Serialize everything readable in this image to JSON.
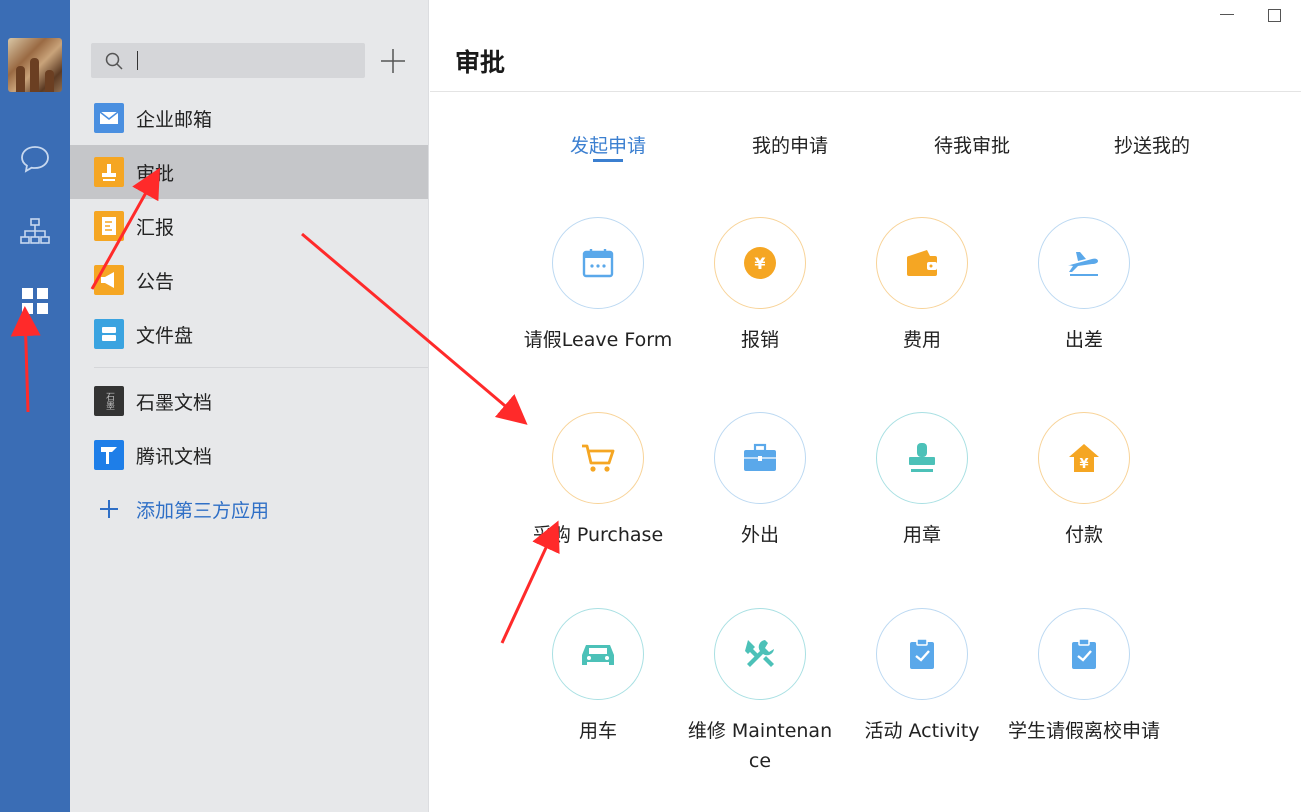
{
  "window": {
    "title": "审批"
  },
  "search": {
    "placeholder": ""
  },
  "nav": {
    "items": [
      {
        "label": "企业邮箱",
        "icon": "mail-icon",
        "color": "#4a8fe0"
      },
      {
        "label": "审批",
        "icon": "stamp-icon",
        "color": "#f5a623"
      },
      {
        "label": "汇报",
        "icon": "report-icon",
        "color": "#f5a623"
      },
      {
        "label": "公告",
        "icon": "megaphone-icon",
        "color": "#f5a623"
      },
      {
        "label": "文件盘",
        "icon": "storage-icon",
        "color": "#3aa3e0"
      },
      {
        "label": "石墨文档",
        "icon": "shimo-icon",
        "color": "#333333",
        "logo_text": "石墨"
      },
      {
        "label": "腾讯文档",
        "icon": "tencent-docs-icon",
        "color": "#1e7ee8"
      },
      {
        "label": "添加第三方应用",
        "icon": "plus-icon",
        "color": "#2f6fc6"
      }
    ]
  },
  "tabs": [
    "发起申请",
    "我的申请",
    "待我审批",
    "抄送我的"
  ],
  "active_tab": 0,
  "apps": [
    {
      "name": "请假Leave Form",
      "icon": "calendar-icon",
      "color": "#5aa8ea"
    },
    {
      "name": "报销",
      "icon": "yuan-coin-icon",
      "color": "#f5a623"
    },
    {
      "name": "费用",
      "icon": "wallet-icon",
      "color": "#f5a623"
    },
    {
      "name": "出差",
      "icon": "airplane-icon",
      "color": "#5aa8ea"
    },
    {
      "name": "采购 Purchase",
      "icon": "cart-icon",
      "color": "#f5a623"
    },
    {
      "name": "外出",
      "icon": "briefcase-icon",
      "color": "#5aa8ea"
    },
    {
      "name": "用章",
      "icon": "stamp-icon",
      "color": "#4cc1b8"
    },
    {
      "name": "付款",
      "icon": "payment-house-icon",
      "color": "#f5a623"
    },
    {
      "name": "用车",
      "icon": "car-icon",
      "color": "#4cc1b8"
    },
    {
      "name": "维修 Maintenance",
      "icon": "tools-icon",
      "color": "#4cc1b8"
    },
    {
      "name": "活动 Activity",
      "icon": "clipboard-check-icon",
      "color": "#5aa8ea"
    },
    {
      "name": "学生请假离校申请",
      "icon": "clipboard-check-icon",
      "color": "#5aa8ea"
    }
  ],
  "colors": {
    "rail": "#3a6db5",
    "accent": "#3b7fd0",
    "annotation": "#ff2a2a"
  }
}
